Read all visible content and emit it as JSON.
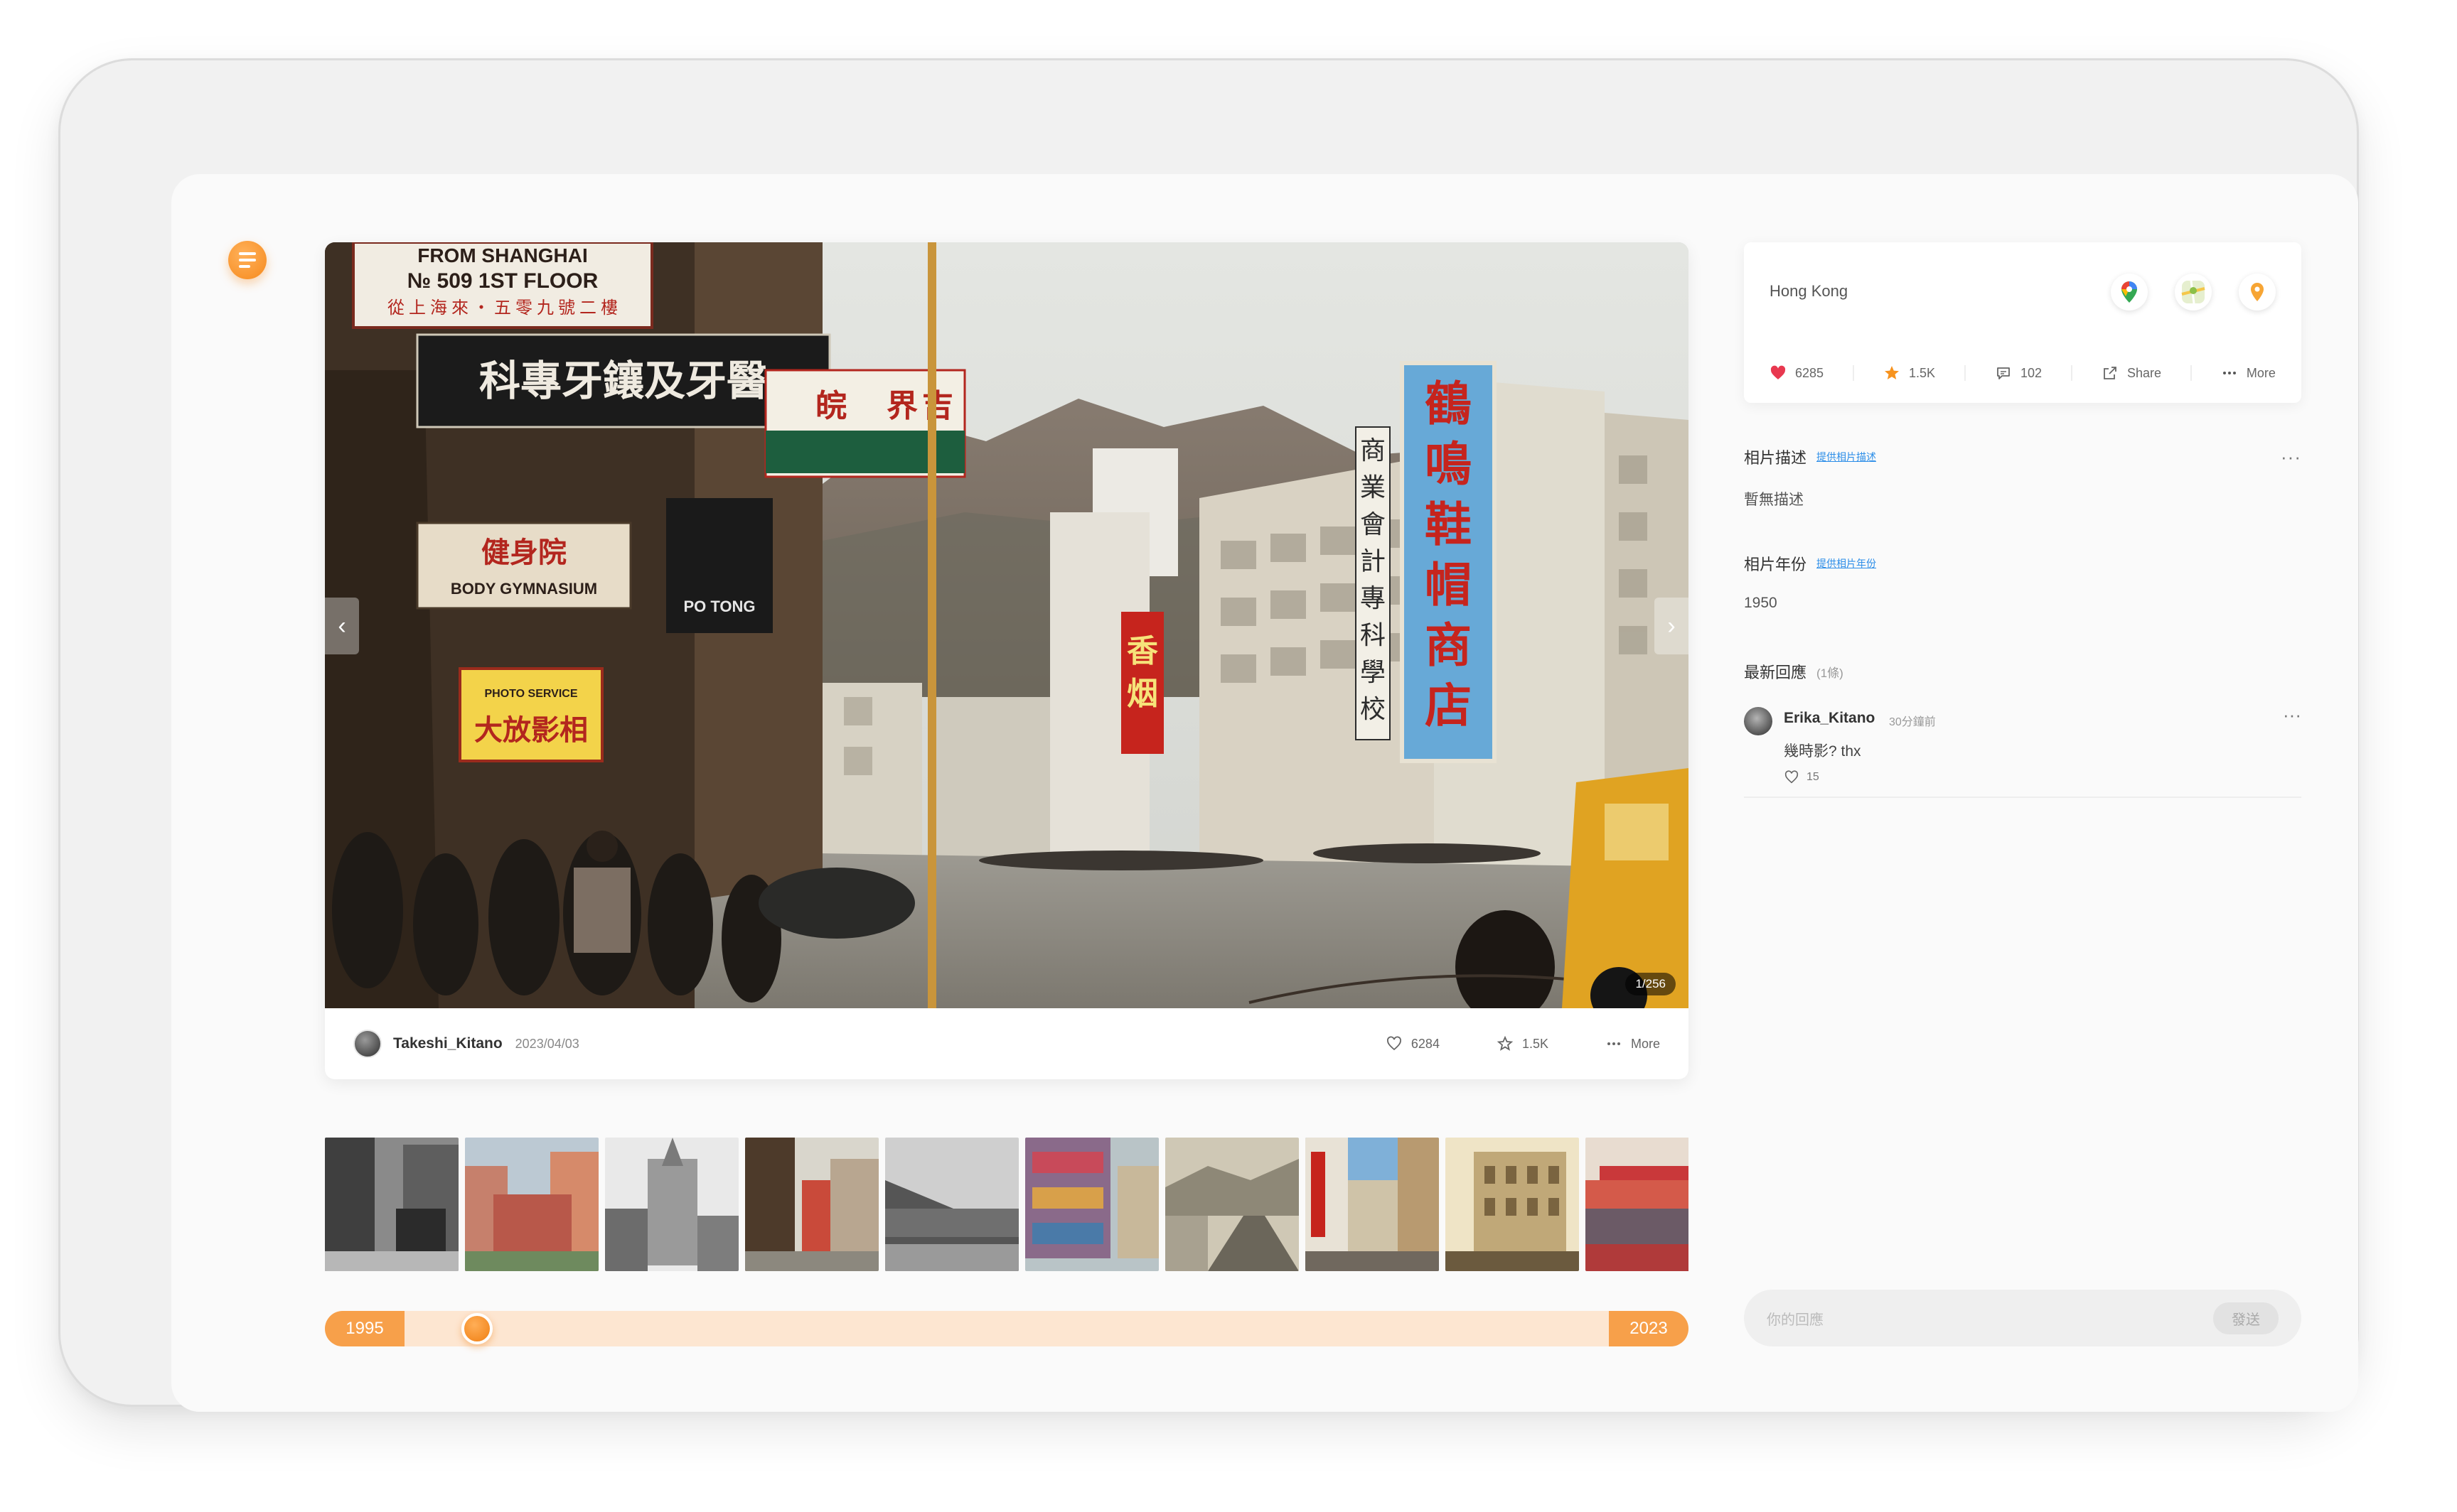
{
  "photo": {
    "counter": "1/256",
    "signs": {
      "shanghai_1": "FROM SHANGHAI",
      "shanghai_2": "№ 509 1ST FLOOR",
      "shanghai_3": "從 上 海 來 ‧ 五 零 九 號 二 樓",
      "dental": "科專牙鑲及牙醫",
      "gym": "健身院",
      "gym_en": "BODY GYMNASIUM",
      "photo_service": "PHOTO SERVICE",
      "photo_cn": "大放影相",
      "shoe_1": "鶴",
      "shoe_2": "鳴",
      "shoe_3": "鞋",
      "shoe_4": "帽",
      "shoe_5": "商",
      "shoe_6": "店",
      "tobacco_1": "香",
      "tobacco_2": "烟",
      "school_1": "商",
      "school_2": "業",
      "school_3": "會",
      "school_4": "計",
      "school_5": "專",
      "school_6": "科",
      "school_7": "學",
      "school_8": "校",
      "world_1": "界",
      "world_2": "吉",
      "wan": "皖",
      "potong": "PO TONG"
    }
  },
  "author": {
    "name": "Takeshi_Kitano",
    "date": "2023/04/03"
  },
  "footer_actions": {
    "likes": "6284",
    "stars": "1.5K",
    "more": "More"
  },
  "timeline": {
    "start_year": "1995",
    "end_year": "2023",
    "position": 0.06
  },
  "info": {
    "location": "Hong Kong",
    "icons": [
      "google-maps-icon",
      "map-app-icon",
      "location-pin-icon"
    ],
    "stats": {
      "likes": "6285",
      "stars": "1.5K",
      "comments": "102",
      "share": "Share",
      "more": "More"
    }
  },
  "description": {
    "title": "相片描述",
    "link": "提供相片描述",
    "body": "暫無描述"
  },
  "year_section": {
    "title": "相片年份",
    "link": "提供相片年份",
    "body": "1950"
  },
  "replies": {
    "title": "最新回應",
    "count": "(1條)",
    "items": [
      {
        "name": "Erika_Kitano",
        "time": "30分鐘前",
        "text": "幾時影? thx",
        "likes": "15"
      }
    ]
  },
  "reply_box": {
    "placeholder": "你的回應",
    "send": "發送"
  },
  "colors": {
    "accent": "#f68a1d",
    "like_red": "#e8384f",
    "star_orange": "#f7931e",
    "link_blue": "#2b8de8"
  }
}
